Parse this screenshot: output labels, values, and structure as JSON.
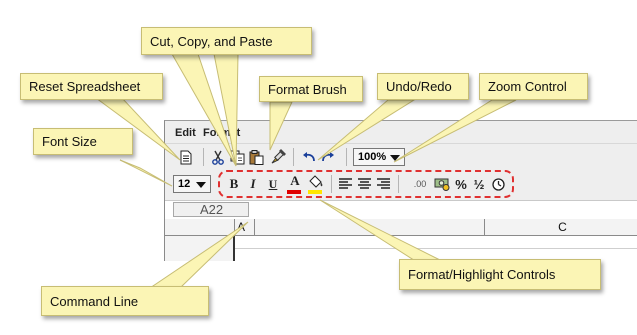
{
  "menubar": {
    "items": [
      "Edit",
      "Format"
    ]
  },
  "toolbar": {
    "zoom_value": "100%",
    "font_size_value": "12",
    "bold_label": "B",
    "italic_label": "I",
    "underline_label": "U",
    "font_color_label": "A",
    "decimal_label": ".00",
    "percent_label": "%",
    "fraction_label": "½"
  },
  "command_line": {
    "cell_reference": "A22"
  },
  "columns": [
    "A",
    "C"
  ],
  "callouts": {
    "cut_copy_paste": "Cut, Copy, and Paste",
    "reset_spreadsheet": "Reset Spreadsheet",
    "format_brush": "Format Brush",
    "undo_redo": "Undo/Redo",
    "zoom_control": "Zoom Control",
    "font_size": "Font Size",
    "command_line": "Command Line",
    "format_highlight_controls": "Format/Highlight Controls"
  },
  "colors": {
    "callout_fill": "#fbf5b5",
    "highlight_dash": "#e03030",
    "font_color_bar": "#e00000",
    "highlight_bar": "#ffe600"
  }
}
